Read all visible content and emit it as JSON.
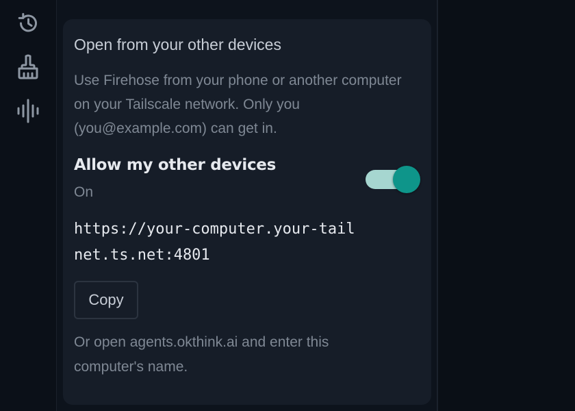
{
  "sidebar": {
    "items": [
      {
        "icon": "history-icon",
        "label": ""
      },
      {
        "icon": "broom-icon",
        "label": ""
      },
      {
        "icon": "audio-waveform-icon",
        "label": ""
      }
    ]
  },
  "card": {
    "title": "Open from your other devices",
    "description": "Use Firehose from your phone or another computer on your Tailscale network. Only you (you@example.com) can get in.",
    "setting": {
      "label": "Allow my other devices",
      "state": "On",
      "enabled": true
    },
    "url": "https://your-computer.your-tailnet.ts.net:4801",
    "copy_label": "Copy",
    "footnote": "Or open agents.okthink.ai and enter this computer's name."
  },
  "colors": {
    "accent": "#0e958a",
    "accent_track": "#a6d6d0",
    "card_bg": "#161d28",
    "page_bg": "#0b1018"
  }
}
